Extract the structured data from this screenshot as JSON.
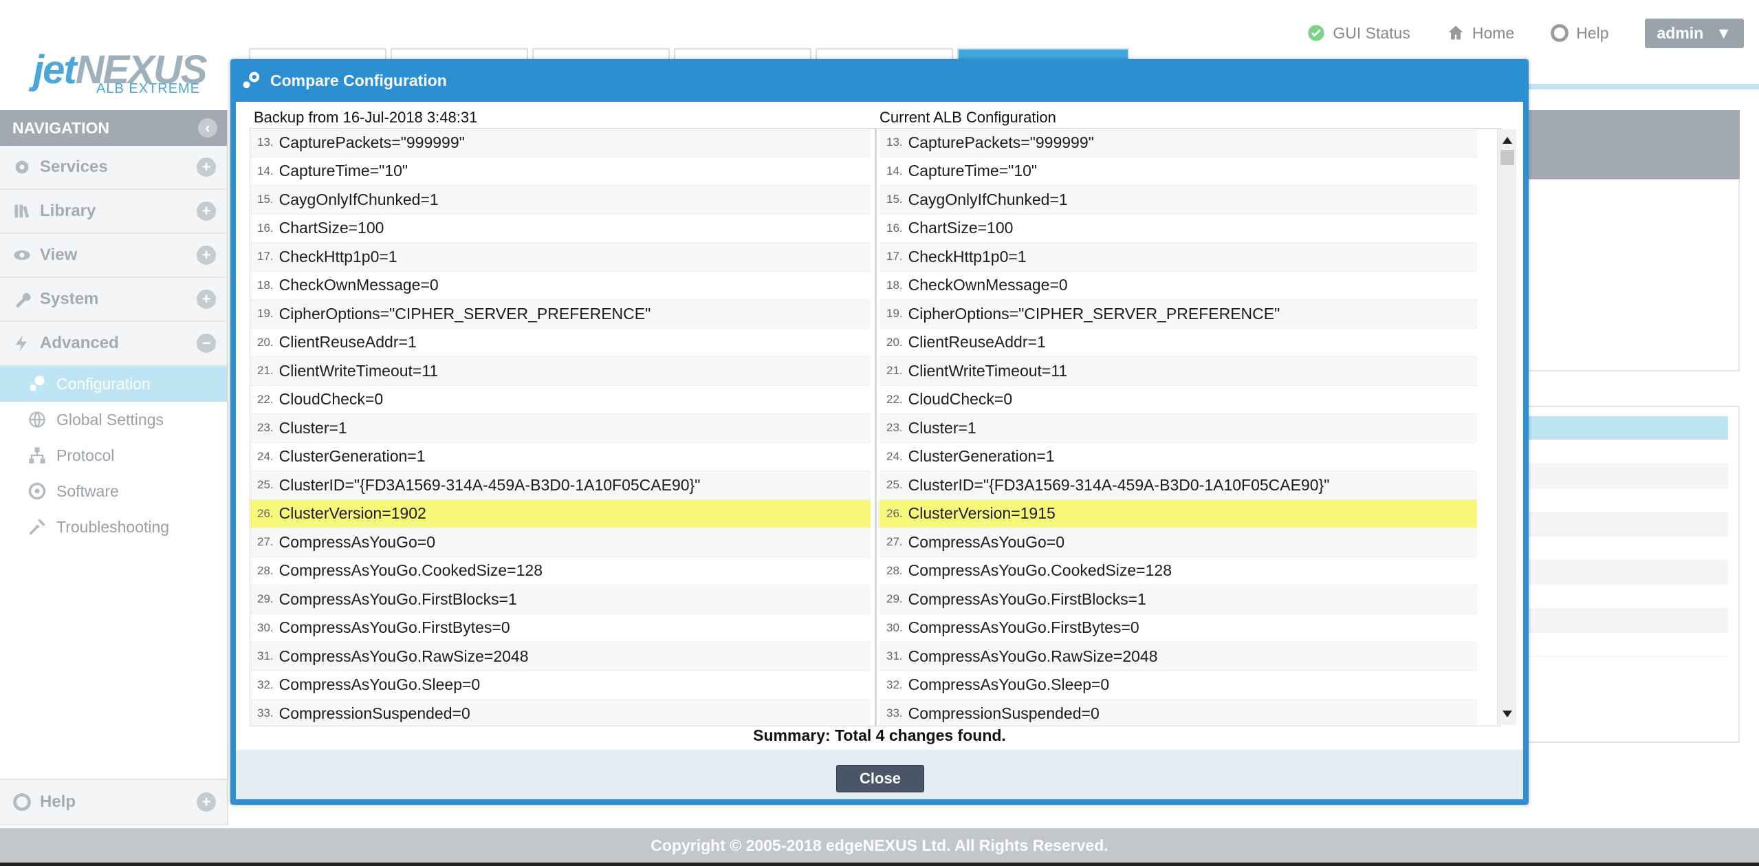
{
  "topnav": {
    "gui_status": "GUI Status",
    "home": "Home",
    "help": "Help",
    "user": "admin"
  },
  "logo": {
    "brand_a": "jet",
    "brand_b": "NEXUS",
    "sub": "ALB EXTREME"
  },
  "sidebar": {
    "header": "NAVIGATION",
    "sections": [
      {
        "label": "Services",
        "icon": "gear-icon",
        "toggle": "+"
      },
      {
        "label": "Library",
        "icon": "library-icon",
        "toggle": "+"
      },
      {
        "label": "View",
        "icon": "eye-icon",
        "toggle": "+"
      },
      {
        "label": "System",
        "icon": "wrench-icon",
        "toggle": "+"
      },
      {
        "label": "Advanced",
        "icon": "bolt-icon",
        "toggle": "−"
      }
    ],
    "advanced_items": [
      {
        "label": "Configuration",
        "icon": "config-icon",
        "active": true
      },
      {
        "label": "Global Settings",
        "icon": "globe-icon"
      },
      {
        "label": "Protocol",
        "icon": "network-icon"
      },
      {
        "label": "Software",
        "icon": "software-icon"
      },
      {
        "label": "Troubleshooting",
        "icon": "tools-icon"
      }
    ],
    "help": {
      "label": "Help",
      "toggle": "+"
    }
  },
  "footer": {
    "copyright": "Copyright © 2005-2018 edgeNEXUS Ltd. All Rights Reserved."
  },
  "dialog": {
    "title": "Compare Configuration",
    "left_title": "Backup from 16-Jul-2018 3:48:31",
    "right_title": "Current ALB Configuration",
    "left_lines": [
      {
        "n": "13.",
        "text": "CapturePackets=\"999999\""
      },
      {
        "n": "14.",
        "text": "CaptureTime=\"10\""
      },
      {
        "n": "15.",
        "text": "CaygOnlyIfChunked=1"
      },
      {
        "n": "16.",
        "text": "ChartSize=100"
      },
      {
        "n": "17.",
        "text": "CheckHttp1p0=1"
      },
      {
        "n": "18.",
        "text": "CheckOwnMessage=0"
      },
      {
        "n": "19.",
        "text": "CipherOptions=\"CIPHER_SERVER_PREFERENCE\""
      },
      {
        "n": "20.",
        "text": "ClientReuseAddr=1"
      },
      {
        "n": "21.",
        "text": "ClientWriteTimeout=11"
      },
      {
        "n": "22.",
        "text": "CloudCheck=0"
      },
      {
        "n": "23.",
        "text": "Cluster=1"
      },
      {
        "n": "24.",
        "text": "ClusterGeneration=1"
      },
      {
        "n": "25.",
        "text": "ClusterID=\"{FD3A1569-314A-459A-B3D0-1A10F05CAE90}\""
      },
      {
        "n": "26.",
        "text": "ClusterVersion=1902",
        "diff": true
      },
      {
        "n": "27.",
        "text": "CompressAsYouGo=0"
      },
      {
        "n": "28.",
        "text": "CompressAsYouGo.CookedSize=128"
      },
      {
        "n": "29.",
        "text": "CompressAsYouGo.FirstBlocks=1"
      },
      {
        "n": "30.",
        "text": "CompressAsYouGo.FirstBytes=0"
      },
      {
        "n": "31.",
        "text": "CompressAsYouGo.RawSize=2048"
      },
      {
        "n": "32.",
        "text": "CompressAsYouGo.Sleep=0"
      },
      {
        "n": "33.",
        "text": "CompressionSuspended=0"
      }
    ],
    "right_lines": [
      {
        "n": "13.",
        "text": "CapturePackets=\"999999\""
      },
      {
        "n": "14.",
        "text": "CaptureTime=\"10\""
      },
      {
        "n": "15.",
        "text": "CaygOnlyIfChunked=1"
      },
      {
        "n": "16.",
        "text": "ChartSize=100"
      },
      {
        "n": "17.",
        "text": "CheckHttp1p0=1"
      },
      {
        "n": "18.",
        "text": "CheckOwnMessage=0"
      },
      {
        "n": "19.",
        "text": "CipherOptions=\"CIPHER_SERVER_PREFERENCE\""
      },
      {
        "n": "20.",
        "text": "ClientReuseAddr=1"
      },
      {
        "n": "21.",
        "text": "ClientWriteTimeout=11"
      },
      {
        "n": "22.",
        "text": "CloudCheck=0"
      },
      {
        "n": "23.",
        "text": "Cluster=1"
      },
      {
        "n": "24.",
        "text": "ClusterGeneration=1"
      },
      {
        "n": "25.",
        "text": "ClusterID=\"{FD3A1569-314A-459A-B3D0-1A10F05CAE90}\""
      },
      {
        "n": "26.",
        "text": "ClusterVersion=1915",
        "diff": true
      },
      {
        "n": "27.",
        "text": "CompressAsYouGo=0"
      },
      {
        "n": "28.",
        "text": "CompressAsYouGo.CookedSize=128"
      },
      {
        "n": "29.",
        "text": "CompressAsYouGo.FirstBlocks=1"
      },
      {
        "n": "30.",
        "text": "CompressAsYouGo.FirstBytes=0"
      },
      {
        "n": "31.",
        "text": "CompressAsYouGo.RawSize=2048"
      },
      {
        "n": "32.",
        "text": "CompressAsYouGo.Sleep=0"
      },
      {
        "n": "33.",
        "text": "CompressionSuspended=0"
      }
    ],
    "summary": "Summary: Total 4 changes found.",
    "close_label": "Close"
  },
  "colors": {
    "dialog_blue": "#2b8fd2",
    "diff_highlight": "#f7f77a",
    "nav_active": "#bfe5f5",
    "close_button": "#4a5568"
  }
}
